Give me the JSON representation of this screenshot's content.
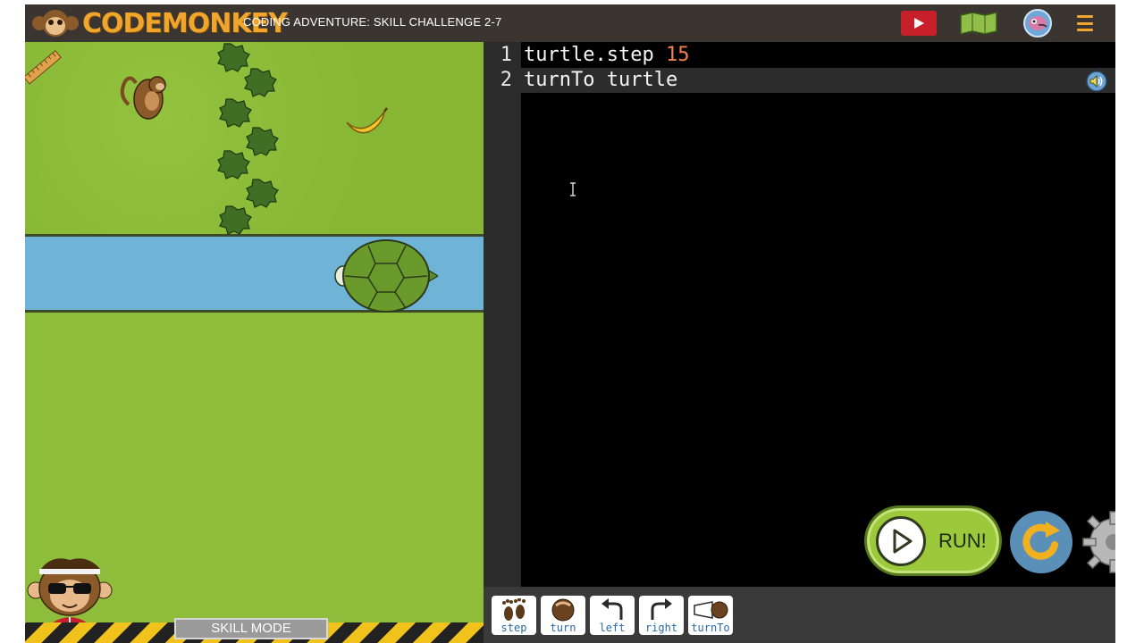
{
  "header": {
    "logo_text": "CODEMONKEY",
    "level_title": "CODING ADVENTURE: SKILL CHALLENGE 2-7",
    "icons": [
      "video-play-icon",
      "map-icon",
      "avatar-icon",
      "hamburger-menu-icon"
    ]
  },
  "game": {
    "mode_label": "SKILL MODE",
    "sprites": [
      "monkey",
      "banana",
      "turtle",
      "bush",
      "ruler",
      "coach"
    ]
  },
  "editor": {
    "lines": [
      {
        "number": "1",
        "text": "turtle.step ",
        "number_token": "15"
      },
      {
        "number": "2",
        "text": "turnTo turtle",
        "number_token": ""
      }
    ]
  },
  "controls": {
    "run_label": "RUN!"
  },
  "toolbar": {
    "tools": [
      {
        "label": "step",
        "icon": "footprints-icon"
      },
      {
        "label": "turn",
        "icon": "monkey-turn-icon"
      },
      {
        "label": "left",
        "icon": "left-arrow-icon"
      },
      {
        "label": "right",
        "icon": "right-arrow-icon"
      },
      {
        "label": "turnTo",
        "icon": "turnto-icon"
      }
    ]
  },
  "colors": {
    "header_bg": "#3b3531",
    "logo": "#f0a52b",
    "grass": "#8dbd3a",
    "river": "#6fb3d6",
    "run_button": "#9cc93c",
    "number_token": "#f08050"
  }
}
